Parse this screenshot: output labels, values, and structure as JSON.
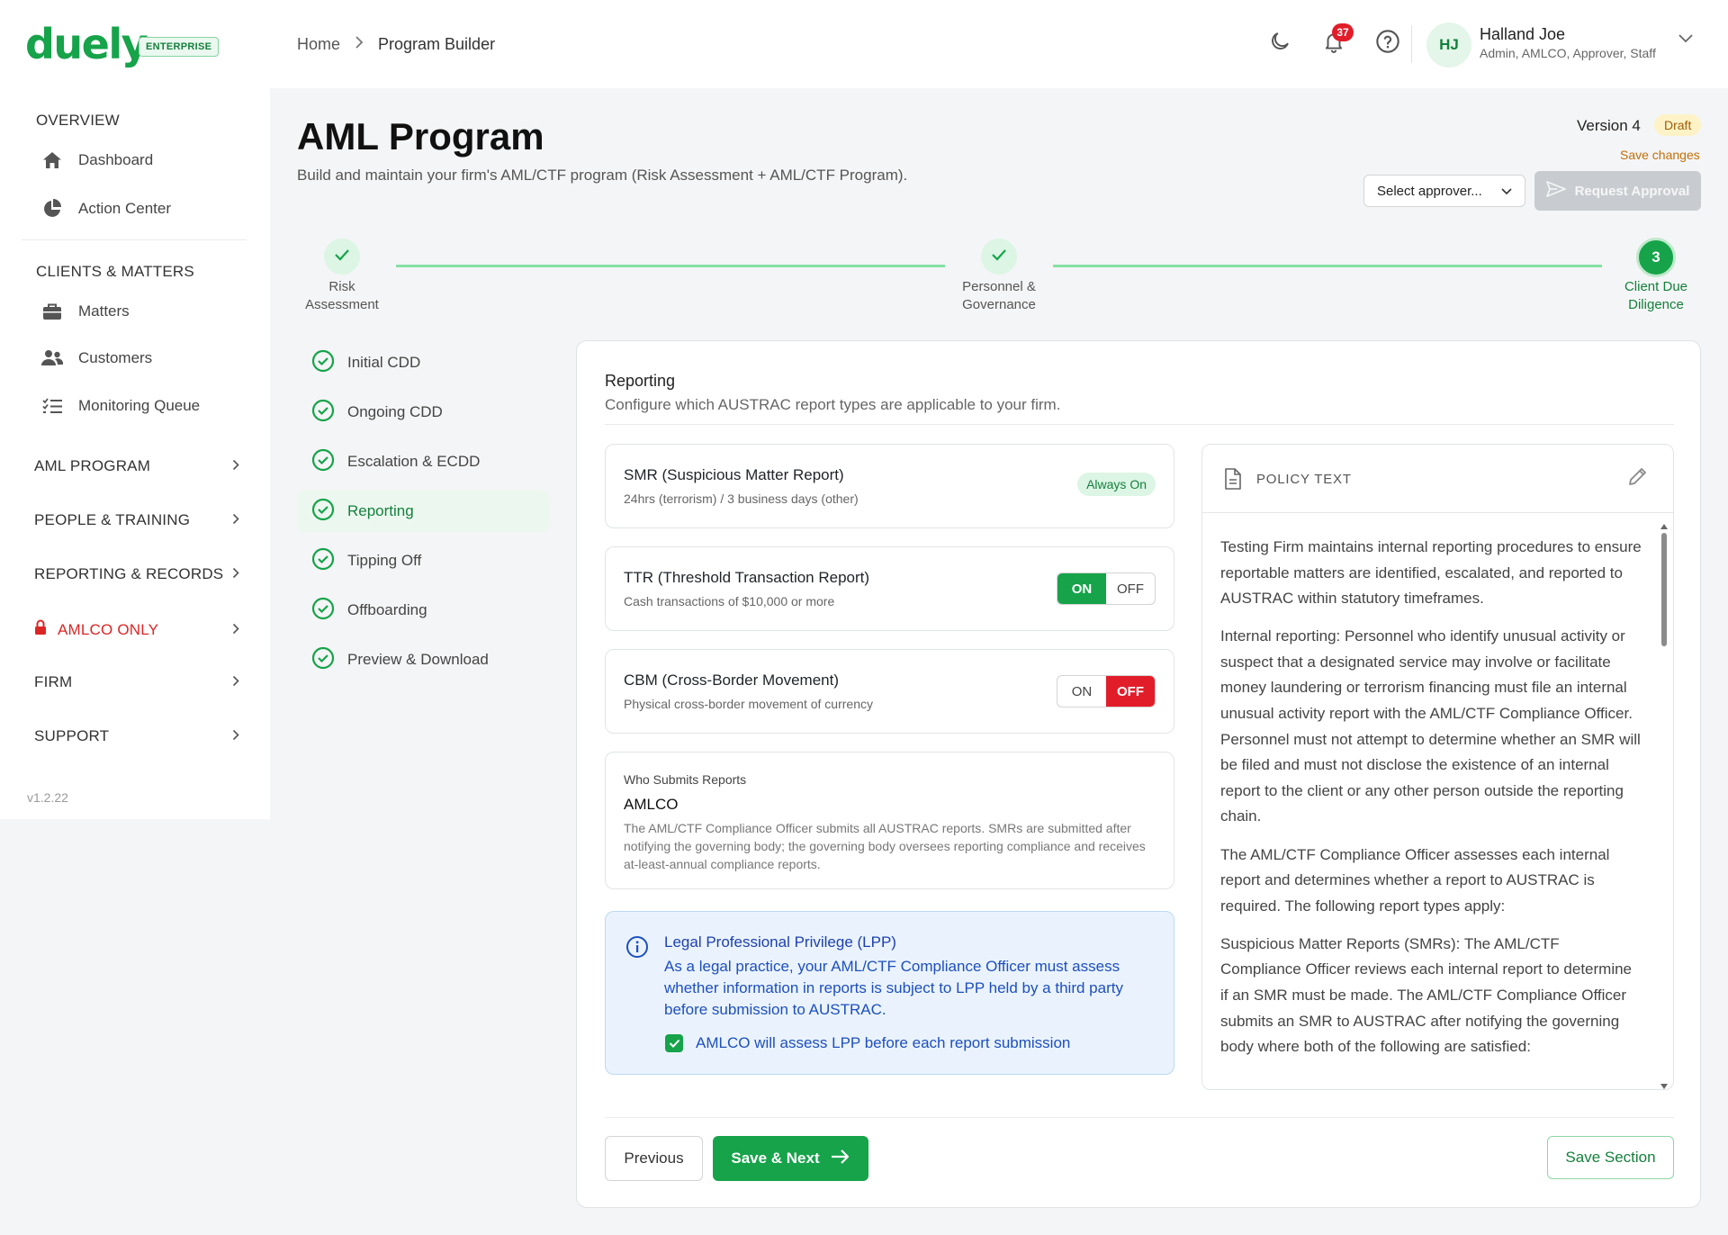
{
  "brand": {
    "name": "duely",
    "badge": "ENTERPRISE",
    "accent": "#16a34a"
  },
  "breadcrumb": {
    "home": "Home",
    "current": "Program Builder"
  },
  "header": {
    "notifications_count": "37",
    "user": {
      "initials": "HJ",
      "name": "Halland Joe",
      "roles": "Admin, AMLCO, Approver, Staff"
    }
  },
  "sidebar": {
    "overview": "OVERVIEW",
    "dashboard": "Dashboard",
    "action_center": "Action Center",
    "clients_matters": "CLIENTS & MATTERS",
    "matters": "Matters",
    "customers": "Customers",
    "monitoring_queue": "Monitoring Queue",
    "groups": [
      "AML PROGRAM",
      "PEOPLE & TRAINING",
      "REPORTING & RECORDS",
      "AMLCO ONLY",
      "FIRM",
      "SUPPORT"
    ],
    "version": "v1.2.22"
  },
  "page": {
    "title": "AML Program",
    "subtitle": "Build and maintain your firm's AML/CTF program (Risk Assessment + AML/CTF Program).",
    "version_label": "Version 4",
    "status": "Draft",
    "save_changes": "Save changes",
    "approver_placeholder": "Select approver...",
    "request_approval": "Request Approval"
  },
  "stepper": [
    {
      "label_line1": "Risk",
      "label_line2": "Assessment",
      "state": "done"
    },
    {
      "label_line1": "Personnel &",
      "label_line2": "Governance",
      "state": "done"
    },
    {
      "number": "3",
      "label_line1": "Client Due",
      "label_line2": "Diligence",
      "state": "active"
    }
  ],
  "sections": [
    "Initial CDD",
    "Ongoing CDD",
    "Escalation & ECDD",
    "Reporting",
    "Tipping Off",
    "Offboarding",
    "Preview & Download"
  ],
  "active_section": "Reporting",
  "reporting": {
    "title": "Reporting",
    "subtitle": "Configure which AUSTRAC report types are applicable to your firm.",
    "smr": {
      "title": "SMR (Suspicious Matter Report)",
      "desc": "24hrs (terrorism) / 3 business days (other)",
      "status": "Always On"
    },
    "ttr": {
      "title": "TTR (Threshold Transaction Report)",
      "desc": "Cash transactions of $10,000 or more",
      "on": "ON",
      "off": "OFF",
      "value": "ON"
    },
    "cbm": {
      "title": "CBM (Cross-Border Movement)",
      "desc": "Physical cross-border movement of currency",
      "on": "ON",
      "off": "OFF",
      "value": "OFF"
    },
    "who_submits": {
      "heading": "Who Submits Reports",
      "value": "AMLCO",
      "desc": "The AML/CTF Compliance Officer submits all AUSTRAC reports. SMRs are submitted after notifying the governing body; the governing body oversees reporting compliance and receives at-least-annual compliance reports."
    },
    "lpp": {
      "title": "Legal Professional Privilege (LPP)",
      "text": "As a legal practice, your AML/CTF Compliance Officer must assess whether information in reports is subject to LPP held by a third party before submission to AUSTRAC.",
      "checkbox_label": "AMLCO will assess LPP before each report submission",
      "checked": true
    },
    "policy": {
      "label": "POLICY TEXT",
      "paragraphs": [
        "Testing Firm maintains internal reporting procedures to ensure reportable matters are identified, escalated, and reported to AUSTRAC within statutory timeframes.",
        "Internal reporting: Personnel who identify unusual activity or suspect that a designated service may involve or facilitate money laundering or terrorism financing must file an internal unusual activity report with the AML/CTF Compliance Officer. Personnel must not attempt to determine whether an SMR will be filed and must not disclose the existence of an internal report to the client or any other person outside the reporting chain.",
        "The AML/CTF Compliance Officer assesses each internal report and determines whether a report to AUSTRAC is required. The following report types apply:",
        "Suspicious Matter Reports (SMRs): The AML/CTF Compliance Officer reviews each internal report to determine if an SMR must be made. The AML/CTF Compliance Officer submits an SMR to AUSTRAC after notifying the governing body where both of the following are satisfied:"
      ]
    }
  },
  "footer": {
    "previous": "Previous",
    "save_next": "Save & Next",
    "save_section": "Save Section"
  }
}
